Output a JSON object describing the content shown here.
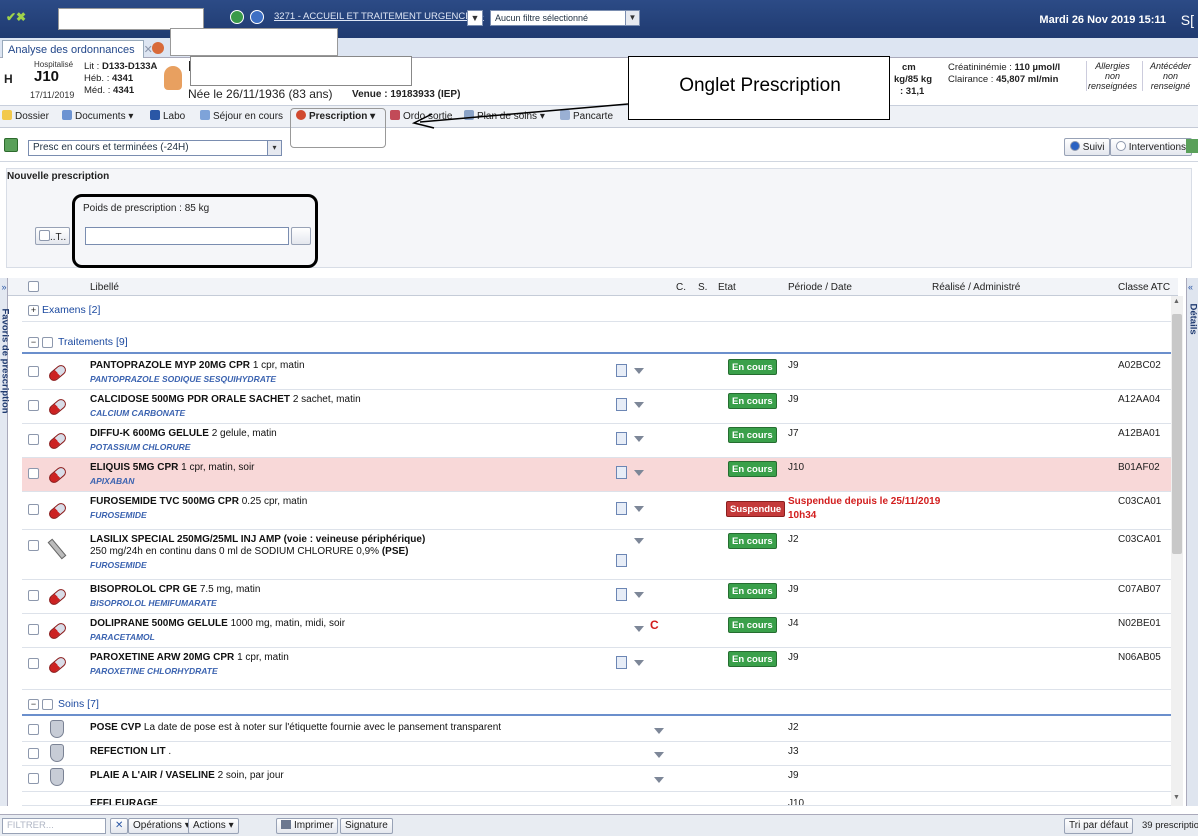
{
  "header": {
    "logo": "✔✖",
    "service": "3271 - ACCUEIL ET TRAITEMENT URGENCES -",
    "filter": "Aucun filtre sélectionné",
    "date": "Mardi 26 Nov 2019 15:11",
    "suffix": "S[",
    "arrow": "▼"
  },
  "tabs": {
    "active": "Analyse des ordonnances",
    "close": "✕"
  },
  "patient": {
    "status": "Hospitalisé",
    "day": "J10",
    "since": "17/11/2019",
    "lit": "Lit : D133-D133A",
    "heb": "Héb. : 4341",
    "med": "Méd. : 4341",
    "lit_label": "Lit :",
    "lit_value": "D133-D133A",
    "heb_label": "Héb. :",
    "heb_value": "4341",
    "med_label": "Méd. :",
    "med_value": "4341",
    "hflag": "H",
    "initial": "F",
    "born": "Née le 26/11/1936 (83 ans)",
    "venue": "Venue : 19183933 (IEP)",
    "cm": "cm",
    "kg": "kg/85 kg",
    "bmi": ": 31,1",
    "creat": "Créatininémie : 110 µmol/l",
    "creat_label": "Créatininémie :",
    "creat_value": "110 µmol/l",
    "clear": "Clairance : 45,807 ml/min",
    "clear_label": "Clairance :",
    "clear_value": "45,807 ml/min",
    "allergy": "Allergies non renseignées",
    "antec": "Antécéder non renseigné"
  },
  "menu": [
    "Dossier",
    "Documents ▾",
    "Labo",
    "Séjour en cours",
    "Prescription ▾",
    "Ordo sortie",
    "Plan de soins ▾",
    "Pancarte"
  ],
  "filter": {
    "value": "Presc en cours et terminées (-24H)",
    "arrow": "▾",
    "suivi": "Suivi",
    "interv": "Interventions"
  },
  "newpresc": {
    "title": "Nouvelle prescription",
    "poids": "Poids de prescription : 85 kg",
    "cbtext": "..T.."
  },
  "cols": {
    "libelle": "Libellé",
    "c": "C.",
    "s": "S.",
    "etat": "Etat",
    "periode": "Période / Date",
    "realise": "Réalisé / Administré",
    "atc": "Classe ATC"
  },
  "groups": {
    "examens": "Examens [2]",
    "traitements": "Traitements [9]",
    "soins": "Soins [7]",
    "plus": "+",
    "minus": "−"
  },
  "rows": [
    {
      "name": "PANTOPRAZOLE MYP 20MG CPR",
      "dose": "1 cpr, matin",
      "sub": "PANTOPRAZOLE SODIQUE SESQUIHYDRATE",
      "etat": "En cours",
      "per": "J9",
      "atc": "A02BC02"
    },
    {
      "name": "CALCIDOSE 500MG PDR ORALE SACHET",
      "dose": "2 sachet, matin",
      "sub": "CALCIUM CARBONATE",
      "etat": "En cours",
      "per": "J9",
      "atc": "A12AA04"
    },
    {
      "name": "DIFFU-K 600MG GELULE",
      "dose": "2 gelule, matin",
      "sub": "POTASSIUM CHLORURE",
      "etat": "En cours",
      "per": "J7",
      "atc": "A12BA01"
    },
    {
      "name": "ELIQUIS 5MG CPR",
      "dose": "1 cpr, matin, soir",
      "sub": "APIXABAN",
      "etat": "En cours",
      "per": "J10",
      "atc": "B01AF02"
    },
    {
      "name": "FUROSEMIDE TVC 500MG CPR",
      "dose": "0.25 cpr, matin",
      "sub": "FUROSEMIDE",
      "etat": "Suspendue",
      "per": "Suspendue depuis le 25/11/2019",
      "per2": "10h34",
      "atc": "C03CA01"
    },
    {
      "name": "LASILIX SPECIAL 250MG/25ML INJ AMP (voie : veineuse périphérique)",
      "line2a": "250 mg/24h en continu dans 0 ml de SODIUM CHLORURE 0,9%",
      "line2b": "(PSE)",
      "sub": "FUROSEMIDE",
      "etat": "En cours",
      "per": "J2",
      "atc": "C03CA01"
    },
    {
      "name": "BISOPROLOL CPR GE",
      "dose": "7.5 mg, matin",
      "sub": "BISOPROLOL HEMIFUMARATE",
      "etat": "En cours",
      "per": "J9",
      "atc": "C07AB07"
    },
    {
      "name": "DOLIPRANE 500MG GELULE",
      "dose": "1000 mg, matin, midi, soir",
      "sub": "PARACETAMOL",
      "c": "C",
      "etat": "En cours",
      "per": "J4",
      "atc": "N02BE01"
    },
    {
      "name": "PAROXETINE ARW 20MG CPR",
      "dose": "1 cpr, matin",
      "sub": "PAROXETINE CHLORHYDRATE",
      "etat": "En cours",
      "per": "J9",
      "atc": "N06AB05"
    }
  ],
  "soins": [
    {
      "name": "POSE CVP",
      "dose": "La date de pose est à noter sur l'étiquette fournie avec le pansement transparent",
      "per": "J2"
    },
    {
      "name": "REFECTION LIT",
      "dose": ".",
      "per": "J3"
    },
    {
      "name": "PLAIE A L'AIR / VASELINE",
      "dose": "2 soin, par jour",
      "per": "J9"
    },
    {
      "name": "EFFLEURAGE",
      "dose": "",
      "per": "J10"
    }
  ],
  "bottom": {
    "filtre": "FILTRER...",
    "ops": "Opérations ▾",
    "actions": "Actions ▾",
    "print": "Imprimer",
    "sign": "Signature",
    "tri": "Tri par défaut",
    "count": "39 prescriptio",
    "x": "✕"
  },
  "side": {
    "favoris": "Favoris de prescription",
    "details": "Détails",
    "chevron": "»",
    "chevron_left": "«"
  },
  "scroll": {
    "up": "▲",
    "down": "▼"
  },
  "annot": {
    "callout": "Onglet Prescription"
  }
}
